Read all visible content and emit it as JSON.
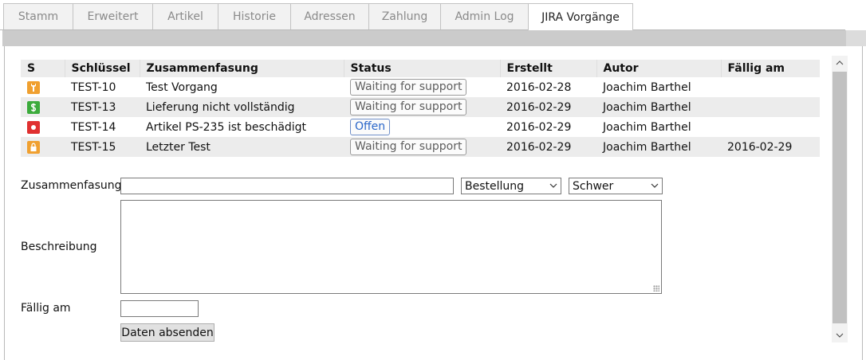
{
  "tabs": [
    {
      "label": "Stamm"
    },
    {
      "label": "Erweitert"
    },
    {
      "label": "Artikel"
    },
    {
      "label": "Historie"
    },
    {
      "label": "Adressen"
    },
    {
      "label": "Zahlung"
    },
    {
      "label": "Admin Log"
    },
    {
      "label": "JIRA Vorgänge",
      "active": true
    }
  ],
  "table": {
    "headers": [
      "S",
      "Schlüssel",
      "Zusammenfasung",
      "Status",
      "Erstellt",
      "Autor",
      "Fällig am"
    ],
    "rows": [
      {
        "icon": "wrench-icon",
        "icon_color": "#f0a030",
        "key": "TEST-10",
        "summary": "Test Vorgang",
        "status": "Waiting for support",
        "status_style": "gray",
        "created": "2016-02-28",
        "author": "Joachim Barthel",
        "due": ""
      },
      {
        "icon": "dollar-icon",
        "icon_color": "#3cab3c",
        "key": "TEST-13",
        "summary": "Lieferung nicht vollständig",
        "status": "Waiting for support",
        "status_style": "gray",
        "created": "2016-02-29",
        "author": "Joachim Barthel",
        "due": ""
      },
      {
        "icon": "record-icon",
        "icon_color": "#e03030",
        "key": "TEST-14",
        "summary": "Artikel PS-235 ist beschädigt",
        "status": "Offen",
        "status_style": "blue",
        "created": "2016-02-29",
        "author": "Joachim Barthel",
        "due": ""
      },
      {
        "icon": "lock-icon",
        "icon_color": "#f0a030",
        "key": "TEST-15",
        "summary": "Letzter Test",
        "status": "Waiting for support",
        "status_style": "gray",
        "created": "2016-02-29",
        "author": "Joachim Barthel",
        "due": "2016-02-29"
      }
    ]
  },
  "form": {
    "summary_label": "Zusammenfasung",
    "summary_value": "",
    "type_select": "Bestellung",
    "priority_select": "Schwer",
    "description_label": "Beschreibung",
    "description_value": "",
    "due_label": "Fällig am",
    "due_value": "",
    "submit_label": "Daten absenden"
  }
}
